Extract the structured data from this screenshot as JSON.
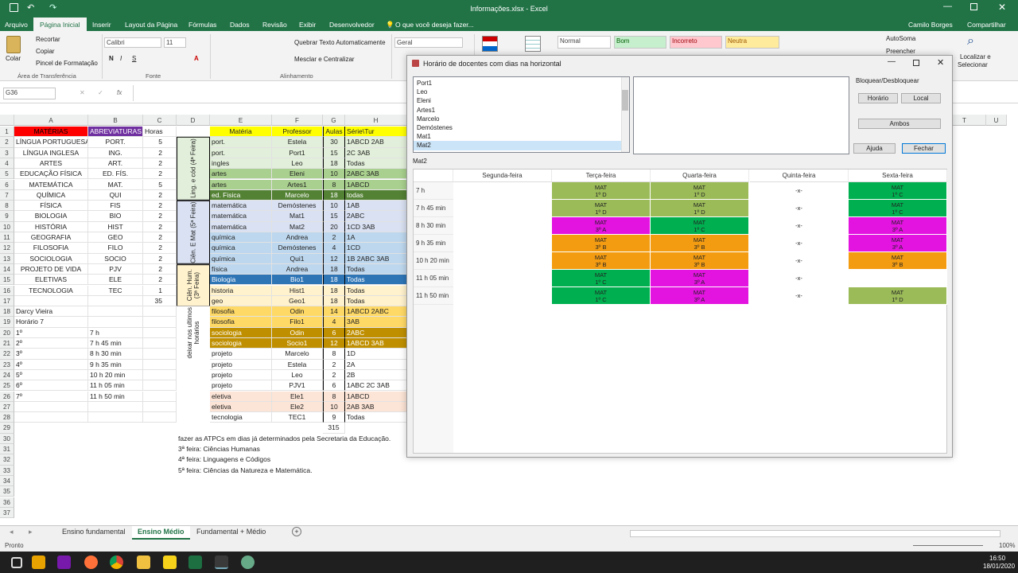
{
  "window": {
    "title": "Informações.xlsx  -  Excel",
    "user": "Camilo Borges",
    "share": "Compartilhar"
  },
  "menu": {
    "items": [
      "Arquivo",
      "Página Inicial",
      "Inserir",
      "Layout da Página",
      "Fórmulas",
      "Dados",
      "Revisão",
      "Exibir",
      "Desenvolvedor"
    ],
    "search": "O que você deseja fazer..."
  },
  "ribbon": {
    "recortar": "Recortar",
    "copiar": "Copiar",
    "pincel": "Pincel de Formatação",
    "colar": "Colar",
    "area_transfer": "Área de Transferência",
    "fonte_label": "Fonte",
    "font_name": "Calibri",
    "font_size": "11",
    "quebrar": "Quebrar Texto Automaticamente",
    "mesclar": "Mesclar e Centralizar",
    "alinhamento": "Alinhamento",
    "numero_format": "Geral",
    "styles": [
      "Normal",
      "Bom",
      "Incorreto",
      "Neutra"
    ],
    "autosoma": "AutoSoma",
    "preencher": "Preencher",
    "localizar": "Localizar e",
    "selecionar": "Selecionar"
  },
  "formula_bar": {
    "name_box": "G36",
    "fx": "fx",
    "value": ""
  },
  "columns": [
    "A",
    "B",
    "C",
    "D",
    "E",
    "F",
    "G",
    "H",
    "T",
    "U"
  ],
  "rows": [
    {
      "r": "1",
      "a": "MATÉRIAS",
      "b": "ABREVIATURAS",
      "c": "Horas",
      "e": "Matéria",
      "f": "Professor",
      "g": "Aulas",
      "h": "Série\\Tur"
    },
    {
      "r": "2",
      "a": "LÍNGUA PORTUGUESA",
      "b": "PORT.",
      "c": "5",
      "e": "port.",
      "f": "Estela",
      "g": "30",
      "h": "1ABCD 2AB"
    },
    {
      "r": "3",
      "a": "LÍNGUA INGLESA",
      "b": "ING.",
      "c": "2",
      "e": "port.",
      "f": "Port1",
      "g": "15",
      "h": "2C 3AB"
    },
    {
      "r": "4",
      "a": "ARTES",
      "b": "ART.",
      "c": "2",
      "e": "ingles",
      "f": "Leo",
      "g": "18",
      "h": "Todas"
    },
    {
      "r": "5",
      "a": "EDUCAÇÃO FÍSICA",
      "b": "ED. FÍS.",
      "c": "2",
      "e": "artes",
      "f": "Eleni",
      "g": "10",
      "h": "2ABC 3AB"
    },
    {
      "r": "6",
      "a": "MATEMÁTICA",
      "b": "MAT.",
      "c": "5",
      "e": "artes",
      "f": "Artes1",
      "g": "8",
      "h": "1ABCD"
    },
    {
      "r": "7",
      "a": "QUÍMICA",
      "b": "QUI",
      "c": "2",
      "e": "ed. Fisica",
      "f": "Marcelo",
      "g": "18",
      "h": "todas"
    },
    {
      "r": "8",
      "a": "FÍSICA",
      "b": "FIS",
      "c": "2",
      "e": "matemática",
      "f": "Demóstenes",
      "g": "10",
      "h": "1AB"
    },
    {
      "r": "9",
      "a": "BIOLOGIA",
      "b": "BIO",
      "c": "2",
      "e": "matemática",
      "f": "Mat1",
      "g": "15",
      "h": "2ABC"
    },
    {
      "r": "10",
      "a": "HISTÓRIA",
      "b": "HIST",
      "c": "2",
      "e": "matemática",
      "f": "Mat2",
      "g": "20",
      "h": "1CD 3AB"
    },
    {
      "r": "11",
      "a": "GEOGRAFIA",
      "b": "GEO",
      "c": "2",
      "e": "química",
      "f": "Andrea",
      "g": "2",
      "h": "1A"
    },
    {
      "r": "12",
      "a": "FILOSOFIA",
      "b": "FILO",
      "c": "2",
      "e": "química",
      "f": "Demóstenes",
      "g": "4",
      "h": "1CD"
    },
    {
      "r": "13",
      "a": "SOCIOLOGIA",
      "b": "SOCIO",
      "c": "2",
      "e": "química",
      "f": "Qui1",
      "g": "12",
      "h": "1B 2ABC 3AB"
    },
    {
      "r": "14",
      "a": "PROJETO DE VIDA",
      "b": "PJV",
      "c": "2",
      "e": "física",
      "f": "Andrea",
      "g": "18",
      "h": "Todas"
    },
    {
      "r": "15",
      "a": "ELETIVAS",
      "b": "ELE",
      "c": "2",
      "e": "Biologia",
      "f": "Bio1",
      "g": "18",
      "h": "Todas"
    },
    {
      "r": "16",
      "a": "TECNOLOGIA",
      "b": "TEC",
      "c": "1",
      "e": "historia",
      "f": "Hist1",
      "g": "18",
      "h": "Todas"
    },
    {
      "r": "17",
      "a": "",
      "b": "",
      "c": "35",
      "e": "geo",
      "f": "Geo1",
      "g": "18",
      "h": "Todas"
    },
    {
      "r": "18",
      "a": "Darcy Vieira",
      "b": "",
      "c": "",
      "e": "filosofia",
      "f": "Odin",
      "g": "14",
      "h": "1ABCD 2ABC"
    },
    {
      "r": "19",
      "a": "Horário 7",
      "b": "",
      "c": "",
      "e": "filosofia",
      "f": "Filo1",
      "g": "4",
      "h": "3AB"
    },
    {
      "r": "20",
      "a": "1º",
      "b": "7 h",
      "c": "",
      "e": "sociologia",
      "f": "Odin",
      "g": "6",
      "h": "2ABC"
    },
    {
      "r": "21",
      "a": "2º",
      "b": "7 h 45 min",
      "c": "",
      "e": "sociologia",
      "f": "Socio1",
      "g": "12",
      "h": "1ABCD 3AB"
    },
    {
      "r": "22",
      "a": "3º",
      "b": "8 h 30 min",
      "c": "",
      "e": "projeto",
      "f": "Marcelo",
      "g": "8",
      "h": "1D"
    },
    {
      "r": "23",
      "a": "4º",
      "b": "9 h 35 min",
      "c": "",
      "e": "projeto",
      "f": "Estela",
      "g": "2",
      "h": "2A"
    },
    {
      "r": "24",
      "a": "5º",
      "b": "10 h 20 min",
      "c": "",
      "e": "projeto",
      "f": "Leo",
      "g": "2",
      "h": "2B"
    },
    {
      "r": "25",
      "a": "6º",
      "b": "11 h 05 min",
      "c": "",
      "e": "projeto",
      "f": "PJV1",
      "g": "6",
      "h": "1ABC 2C 3AB"
    },
    {
      "r": "26",
      "a": "7º",
      "b": "11 h 50 min",
      "c": "",
      "e": "eletiva",
      "f": "Ele1",
      "g": "8",
      "h": "1ABCD"
    },
    {
      "r": "27",
      "a": "",
      "b": "",
      "c": "",
      "e": "eletiva",
      "f": "Ele2",
      "g": "10",
      "h": "2AB 3AB"
    },
    {
      "r": "28",
      "a": "",
      "b": "",
      "c": "",
      "e": "tecnologia",
      "f": "TEC1",
      "g": "9",
      "h": "Todas"
    },
    {
      "r": "29",
      "a": "",
      "b": "",
      "c": "",
      "e": "",
      "f": "",
      "g": "315",
      "h": ""
    },
    {
      "r": "30",
      "a": "",
      "b": "",
      "c": "",
      "e": "",
      "f": "",
      "g": "",
      "h": ""
    },
    {
      "r": "31",
      "a": "",
      "b": "",
      "c": "",
      "e": "",
      "f": "",
      "g": "",
      "h": ""
    },
    {
      "r": "32",
      "a": "",
      "b": "",
      "c": "",
      "e": "",
      "f": "",
      "g": "",
      "h": ""
    },
    {
      "r": "33",
      "a": "",
      "b": "",
      "c": "",
      "e": "",
      "f": "",
      "g": "",
      "h": ""
    },
    {
      "r": "34",
      "a": "",
      "b": "",
      "c": "",
      "e": "",
      "f": "",
      "g": "",
      "h": ""
    },
    {
      "r": "35",
      "a": "",
      "b": "",
      "c": "",
      "e": "",
      "f": "",
      "g": "",
      "h": ""
    },
    {
      "r": "36",
      "a": "",
      "b": "",
      "c": "",
      "e": "",
      "f": "",
      "g": "",
      "h": ""
    },
    {
      "r": "37",
      "a": "",
      "b": "",
      "c": "",
      "e": "",
      "f": "",
      "g": "",
      "h": ""
    }
  ],
  "groups": [
    {
      "label": "Ling. e cód (4ª Feira)"
    },
    {
      "label": "Ciên. E Mat (5ª Feira)"
    },
    {
      "label": "Ciên. Hum. (3ª Feira)"
    },
    {
      "label": "deixar nos ultimos horários"
    }
  ],
  "notes": [
    "fazer as ATPCs em dias já determinados pela Secretaria da Educação.",
    "3ª feira: Ciências Humanas",
    "4ª feira: Linguagens e Códigos",
    "5ª feira: Ciências da Natureza e Matemática."
  ],
  "sheet_tabs": [
    "Ensino fundamental",
    "Ensino Médio",
    "Fundamental + Médio"
  ],
  "status": {
    "left": "Pronto",
    "zoom": "100%"
  },
  "clock": {
    "time": "16:50",
    "date": "18/01/2020"
  },
  "dialog": {
    "title": "Horário de docentes com dias na horizontal",
    "list": [
      "Port1",
      "Leo",
      "Eleni",
      "Artes1",
      "Marcelo",
      "Demóstenes",
      "Mat1",
      "Mat2"
    ],
    "selected_index": 7,
    "selected_label": "Mat2",
    "lock_label": "Bloquear/Desbloquear",
    "btn_horario": "Horário",
    "btn_local": "Local",
    "btn_ambos": "Ambos",
    "btn_ajuda": "Ajuda",
    "btn_fechar": "Fechar",
    "days": [
      "Segunda-feira",
      "Terça-feira",
      "Quarta-feira",
      "Quinta-feira",
      "Sexta-feira"
    ],
    "times": [
      "7 h",
      "7 h 45 min",
      "8 h 30 min",
      "9 h 35 min",
      "10 h 20 min",
      "11 h 05 min",
      "11 h 50 min"
    ],
    "schedule": [
      [
        {
          "t": ""
        },
        {
          "t": "MAT\n1º D",
          "c": "#9bbb59"
        },
        {
          "t": "MAT\n1º D",
          "c": "#9bbb59"
        },
        {
          "t": "-x-"
        },
        {
          "t": "MAT\n1º C",
          "c": "#00b050"
        }
      ],
      [
        {
          "t": ""
        },
        {
          "t": "MAT\n1º D",
          "c": "#9bbb59"
        },
        {
          "t": "MAT\n1º D",
          "c": "#9bbb59"
        },
        {
          "t": "-x-"
        },
        {
          "t": "MAT\n1º C",
          "c": "#00b050"
        }
      ],
      [
        {
          "t": ""
        },
        {
          "t": "MAT\n3º A",
          "c": "#e313e0"
        },
        {
          "t": "MAT\n1º C",
          "c": "#00b050"
        },
        {
          "t": "-x-"
        },
        {
          "t": "MAT\n3º A",
          "c": "#e313e0"
        }
      ],
      [
        {
          "t": ""
        },
        {
          "t": "MAT\n3º B",
          "c": "#f39c12"
        },
        {
          "t": "MAT\n3º B",
          "c": "#f39c12"
        },
        {
          "t": "-x-"
        },
        {
          "t": "MAT\n3º A",
          "c": "#e313e0"
        }
      ],
      [
        {
          "t": ""
        },
        {
          "t": "MAT\n3º B",
          "c": "#f39c12"
        },
        {
          "t": "MAT\n3º B",
          "c": "#f39c12"
        },
        {
          "t": "-x-"
        },
        {
          "t": "MAT\n3º B",
          "c": "#f39c12"
        }
      ],
      [
        {
          "t": ""
        },
        {
          "t": "MAT\n1º C",
          "c": "#00b050"
        },
        {
          "t": "MAT\n3º A",
          "c": "#e313e0"
        },
        {
          "t": "-x-"
        },
        {
          "t": ""
        }
      ],
      [
        {
          "t": ""
        },
        {
          "t": "MAT\n1º C",
          "c": "#00b050"
        },
        {
          "t": "MAT\n3º A",
          "c": "#e313e0"
        },
        {
          "t": "-x-"
        },
        {
          "t": "MAT\n1º D",
          "c": "#9bbb59"
        }
      ]
    ]
  },
  "colors": {
    "excel_green": "#217346",
    "materias_red": "#ff0000",
    "abrev_purple": "#7030a0",
    "header_yellow": "#ffff00"
  }
}
